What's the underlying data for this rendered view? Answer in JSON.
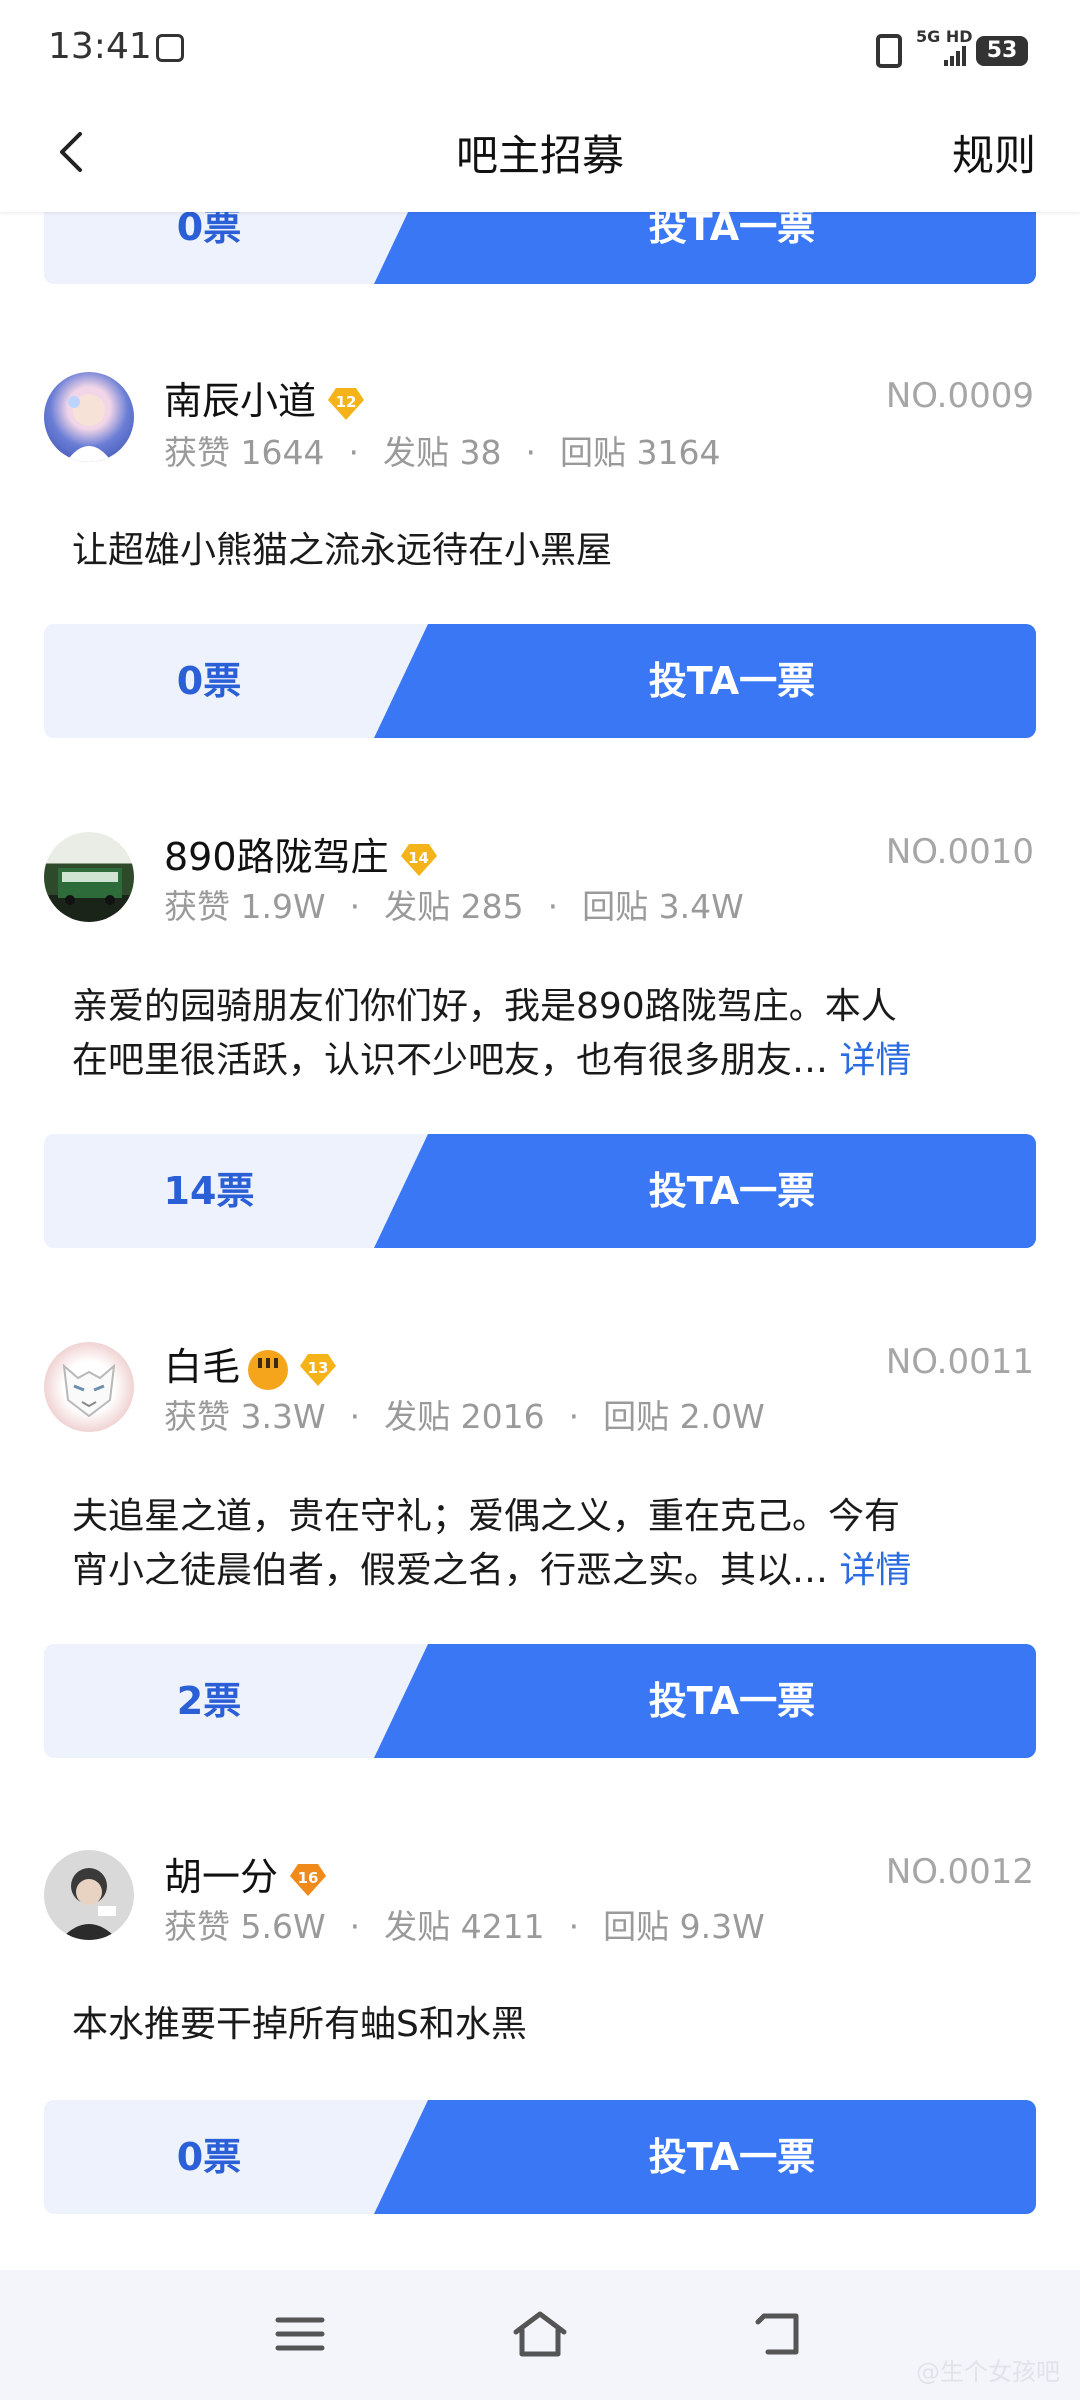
{
  "status": {
    "time": "13:41",
    "network": "5G HD",
    "battery": "53"
  },
  "header": {
    "title": "吧主招募",
    "rule": "规则"
  },
  "vote_label": "投TA一票",
  "top_partial": {
    "count": "0票"
  },
  "candidates": [
    {
      "name": "南辰小道",
      "level": "12",
      "no": "NO.0009",
      "likes": "获赞 1644",
      "posts": "发贴 38",
      "replies": "回贴 3164",
      "desc": "让超雄小熊猫之流永远待在小黑屋",
      "more": "",
      "votes": "0票"
    },
    {
      "name": "890路陇驾庄",
      "level": "14",
      "no": "NO.0010",
      "likes": "获赞 1.9W",
      "posts": "发贴 285",
      "replies": "回贴 3.4W",
      "desc_line1": "亲爱的园骑朋友们你们好，我是890路陇驾庄。本人",
      "desc_line2": "在吧里很活跃，认识不少吧友，也有很多朋友…",
      "more": "详情",
      "votes": "14票"
    },
    {
      "name": "白毛",
      "level": "13",
      "no": "NO.0011",
      "likes": "获赞 3.3W",
      "posts": "发贴 2016",
      "replies": "回贴 2.0W",
      "desc_line1": "夫追星之道，贵在守礼；爱偶之义，重在克己。今有",
      "desc_line2": "宵小之徒晨伯者，假爱之名，行恶之实。其以…",
      "more": "详情",
      "votes": "2票"
    },
    {
      "name": "胡一分",
      "level": "16",
      "no": "NO.0012",
      "likes": "获赞 5.6W",
      "posts": "发贴 4211",
      "replies": "回贴 9.3W",
      "desc": "本水推要干掉所有蚰S和水黑",
      "more": "",
      "votes": "0票"
    }
  ],
  "watermark": "@生个女孩吧",
  "colors": {
    "accent": "#3a77f5",
    "count_bg": "#edf2fc",
    "badge": "#f5b31a"
  }
}
